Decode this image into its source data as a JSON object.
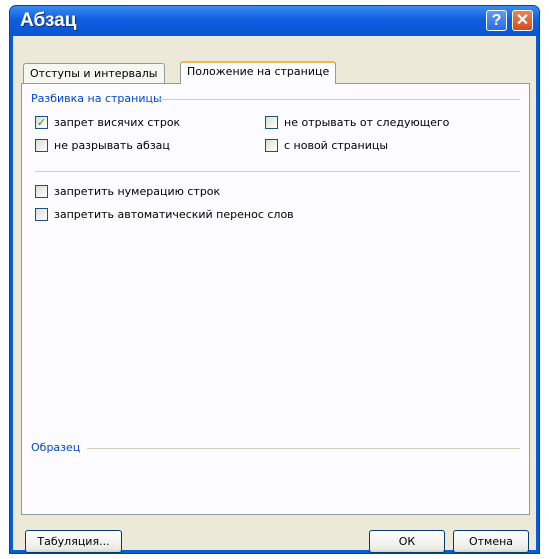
{
  "window": {
    "title": "Абзац",
    "help_glyph": "?",
    "close_glyph": "✕"
  },
  "tabs": [
    {
      "label": "Отступы и интервалы",
      "active": false
    },
    {
      "label": "Положение на странице",
      "active": true
    }
  ],
  "pagination": {
    "group_label": "Разбивка на страницы",
    "options": [
      {
        "label": "запрет висячих строк",
        "checked": true
      },
      {
        "label": "не отрывать от следующего",
        "checked": false
      },
      {
        "label": "не разрывать абзац",
        "checked": false
      },
      {
        "label": "с новой страницы",
        "checked": false
      }
    ]
  },
  "formatting": {
    "options": [
      {
        "label": "запретить нумерацию строк",
        "checked": false
      },
      {
        "label": "запретить автоматический перенос слов",
        "checked": false
      }
    ]
  },
  "preview": {
    "group_label": "Образец"
  },
  "buttons": {
    "tabs_label": "Табуляция...",
    "ok_label": "ОК",
    "cancel_label": "Отмена"
  },
  "colors": {
    "title_bar": "#0a55d2",
    "dialog_bg": "#ece9d8",
    "group_label": "#0046d5",
    "check": "#21a121"
  },
  "icons": {
    "checkmark": "✓"
  }
}
